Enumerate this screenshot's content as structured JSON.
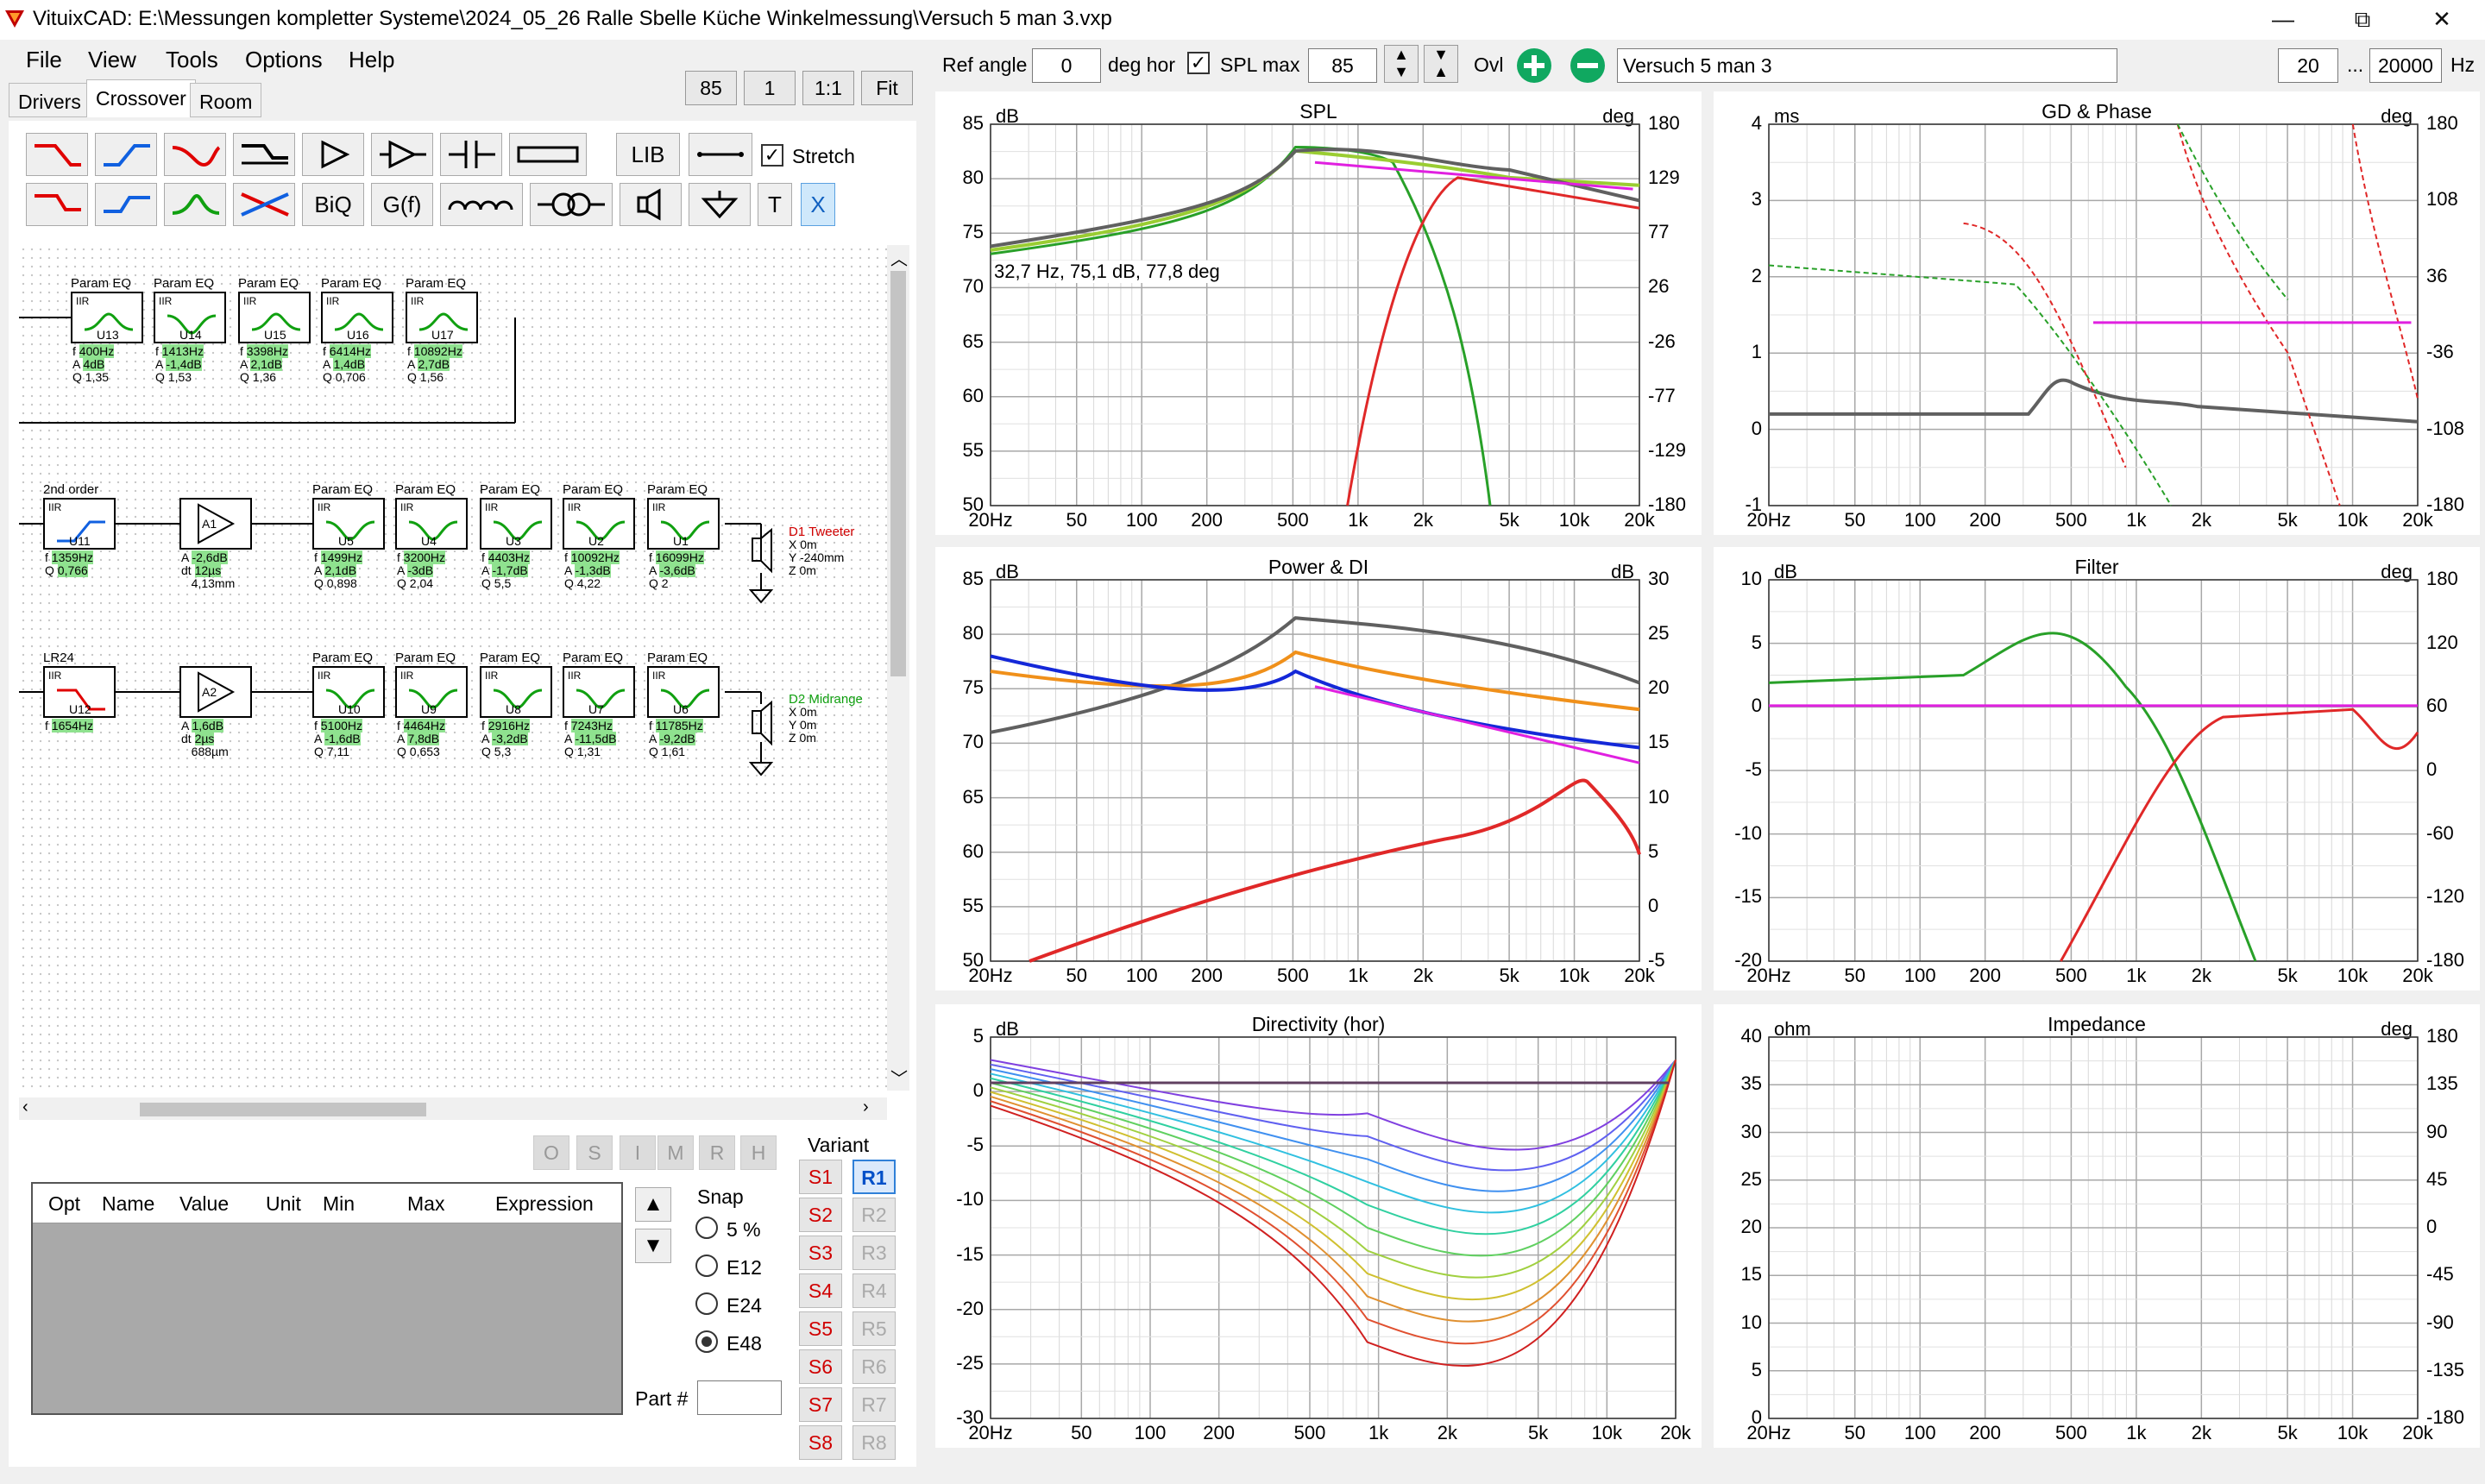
{
  "window": {
    "title": "VituixCAD: E:\\Messungen kompletter Systeme\\2024_05_26 Ralle Sbelle Küche Winkelmessung\\Versuch 5 man 3.vxp",
    "minimize": "—",
    "restore": "⧉",
    "close": "✕"
  },
  "menu": [
    "File",
    "View",
    "Tools",
    "Options",
    "Help"
  ],
  "tabs": [
    "Drivers",
    "Crossover",
    "Room"
  ],
  "top_small_buttons": [
    "85",
    "1",
    "1:1",
    "Fit"
  ],
  "toolbar": {
    "row1": [
      "LIB"
    ],
    "row2": [
      "BiQ",
      "G(f)",
      "T",
      "X"
    ],
    "stretch_label": "Stretch"
  },
  "header_controls": {
    "ref_angle_label": "Ref angle",
    "ref_angle_value": "0",
    "deg_hor_label": "deg hor",
    "spl_max_label": "SPL max",
    "spl_max_value": "85",
    "ovl_label": "Ovl",
    "variant_name": "Versuch 5 man 3",
    "freq_from": "20",
    "freq_sep": "...",
    "freq_to": "20000",
    "hz_label": "Hz"
  },
  "schematic": {
    "row1": [
      {
        "title": "Param EQ",
        "id": "U13",
        "f": "400Hz",
        "A": "4dB",
        "Q": "1,35"
      },
      {
        "title": "Param EQ",
        "id": "U14",
        "f": "1413Hz",
        "A": "-1,4dB",
        "Q": "1,53"
      },
      {
        "title": "Param EQ",
        "id": "U15",
        "f": "3398Hz",
        "A": "2,1dB",
        "Q": "1,36"
      },
      {
        "title": "Param EQ",
        "id": "U16",
        "f": "6414Hz",
        "A": "1,4dB",
        "Q": "0,706"
      },
      {
        "title": "Param EQ",
        "id": "U17",
        "f": "10892Hz",
        "A": "2,7dB",
        "Q": "1,56"
      }
    ],
    "row2_filter": {
      "title": "2nd order",
      "id": "U11",
      "f": "1359Hz",
      "Q": "0,766"
    },
    "row2_amp": {
      "id": "A1",
      "A": "-2,6dB",
      "dt": "12µs",
      "dist": "4,13mm"
    },
    "row2": [
      {
        "title": "Param EQ",
        "id": "U5",
        "f": "1499Hz",
        "A": "2,1dB",
        "Q": "0,898"
      },
      {
        "title": "Param EQ",
        "id": "U4",
        "f": "3200Hz",
        "A": "-3dB",
        "Q": "2,04"
      },
      {
        "title": "Param EQ",
        "id": "U3",
        "f": "4403Hz",
        "A": "-1,7dB",
        "Q": "5,5"
      },
      {
        "title": "Param EQ",
        "id": "U2",
        "f": "10092Hz",
        "A": "-1,3dB",
        "Q": "4,22"
      },
      {
        "title": "Param EQ",
        "id": "U1",
        "f": "16099Hz",
        "A": "-3,6dB",
        "Q": "2"
      }
    ],
    "row2_driver": {
      "name": "D1 Tweeter",
      "X": "X 0m",
      "Y": "Y -240mm",
      "Z": "Z 0m"
    },
    "row3_filter": {
      "title": "LR24",
      "id": "U12",
      "f": "1654Hz"
    },
    "row3_amp": {
      "id": "A2",
      "A": "1,6dB",
      "dt": "2µs",
      "dist": "688µm"
    },
    "row3": [
      {
        "title": "Param EQ",
        "id": "U10",
        "f": "5100Hz",
        "A": "-1,6dB",
        "Q": "7,11"
      },
      {
        "title": "Param EQ",
        "id": "U9",
        "f": "4464Hz",
        "A": "7,8dB",
        "Q": "0,653"
      },
      {
        "title": "Param EQ",
        "id": "U8",
        "f": "2916Hz",
        "A": "-3,2dB",
        "Q": "5,3"
      },
      {
        "title": "Param EQ",
        "id": "U7",
        "f": "7243Hz",
        "A": "-11,5dB",
        "Q": "1,31"
      },
      {
        "title": "Param EQ",
        "id": "U6",
        "f": "11785Hz",
        "A": "-9,2dB",
        "Q": "1,61"
      }
    ],
    "row3_driver": {
      "name": "D2 Midrange",
      "X": "X 0m",
      "Y": "Y 0m",
      "Z": "Z 0m"
    }
  },
  "opt_buttons": [
    "O",
    "S",
    "I",
    "M",
    "R",
    "H"
  ],
  "table_headers": [
    "Opt",
    "Name",
    "Value",
    "Unit",
    "Min",
    "Max",
    "Expression"
  ],
  "snap": {
    "label": "Snap",
    "options": [
      "5 %",
      "E12",
      "E24",
      "E48"
    ],
    "selected": "E48"
  },
  "part_label": "Part #",
  "variant": {
    "label": "Variant",
    "s": [
      "S1",
      "S2",
      "S3",
      "S4",
      "S5",
      "S6",
      "S7",
      "S8"
    ],
    "r": [
      "R1",
      "R2",
      "R3",
      "R4",
      "R5",
      "R6",
      "R7",
      "R8"
    ],
    "selected_r": "R1"
  },
  "x_ticks": [
    "20Hz",
    "50",
    "100",
    "200",
    "500",
    "1k",
    "2k",
    "5k",
    "10k",
    "20k"
  ],
  "graphs": {
    "spl": {
      "title": "SPL",
      "left_unit": "dB",
      "right_unit": "deg",
      "left_ticks": [
        "85",
        "80",
        "75",
        "70",
        "65",
        "60",
        "55",
        "50"
      ],
      "right_ticks": [
        "180",
        "129",
        "77",
        "26",
        "-26",
        "-77",
        "-129",
        "-180"
      ],
      "annotation": "32,7 Hz, 75,1 dB, 77,8 deg"
    },
    "gd_phase": {
      "title": "GD & Phase",
      "left_unit": "ms",
      "right_unit": "deg",
      "left_ticks": [
        "4",
        "3",
        "2",
        "1",
        "0",
        "-1"
      ],
      "right_ticks": [
        "180",
        "108",
        "36",
        "-36",
        "-108",
        "-180"
      ]
    },
    "power_di": {
      "title": "Power & DI",
      "left_unit": "dB",
      "right_unit": "dB",
      "left_ticks": [
        "85",
        "80",
        "75",
        "70",
        "65",
        "60",
        "55",
        "50"
      ],
      "right_ticks": [
        "30",
        "25",
        "20",
        "15",
        "10",
        "5",
        "0",
        "-5"
      ]
    },
    "filter": {
      "title": "Filter",
      "left_unit": "dB",
      "right_unit": "deg",
      "left_ticks": [
        "10",
        "5",
        "0",
        "-5",
        "-10",
        "-15",
        "-20"
      ],
      "right_ticks": [
        "180",
        "120",
        "60",
        "0",
        "-60",
        "-120",
        "-180"
      ]
    },
    "directivity": {
      "title": "Directivity (hor)",
      "left_unit": "dB",
      "right_unit": "",
      "left_ticks": [
        "5",
        "0",
        "-5",
        "-10",
        "-15",
        "-20",
        "-25",
        "-30"
      ],
      "right_ticks": []
    },
    "impedance": {
      "title": "Impedance",
      "left_unit": "ohm",
      "right_unit": "deg",
      "left_ticks": [
        "40",
        "35",
        "30",
        "25",
        "20",
        "15",
        "10",
        "5",
        "0"
      ],
      "right_ticks": [
        "180",
        "135",
        "90",
        "45",
        "0",
        "-45",
        "-90",
        "-135",
        "-180"
      ]
    }
  }
}
